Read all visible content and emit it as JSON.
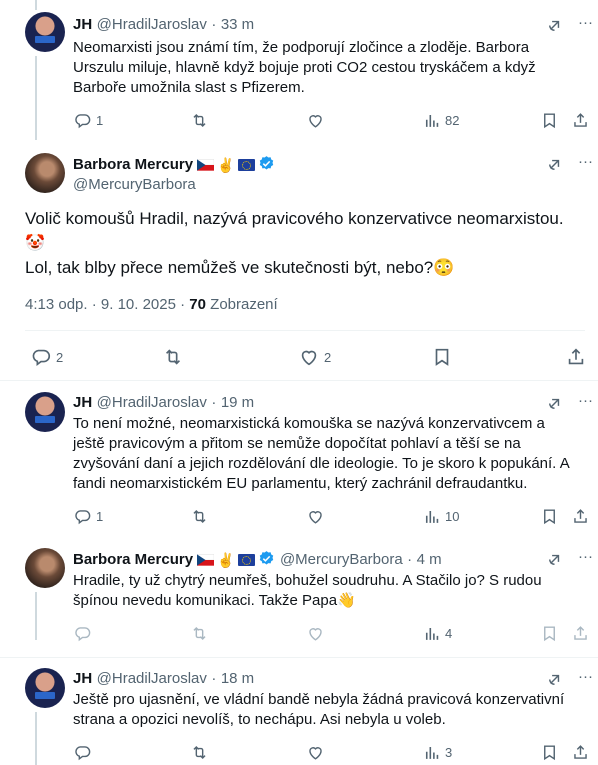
{
  "tweets": [
    {
      "name": "JH",
      "handle": "@HradilJaroslav",
      "time": "33 m",
      "text": "Neomarxisti jsou známí tím, že podporují zločince a zloděje. Barbora Urszulu miluje, hlavně když bojuje proti CO2 cestou tryskáčem a když Barboře umožnila slast s Pfizerem.",
      "replies": "1",
      "views": "82"
    },
    {
      "name": "Barbora Mercury",
      "handle": "@MercuryBarbora",
      "text_line1": "Volič komoušů Hradil, nazývá pravicového konzervativce neomarxistou.",
      "text_line2": "Lol, tak blby přece nemůžeš ve skutečnosti být, nebo?",
      "timestamp": "4:13 odp. · 9. 10. 2025",
      "views_count": "70",
      "views_label": "Zobrazení",
      "replies": "2",
      "likes": "2"
    },
    {
      "name": "JH",
      "handle": "@HradilJaroslav",
      "time": "19 m",
      "text": "To není možné, neomarxistická komouška se nazývá konzervativcem a ještě pravicovým a přitom se nemůže dopočítat pohlaví a těší se na zvyšování daní a jejich rozdělování dle ideologie. To je skoro k popukání. A fandi neomarxistickém EU parlamentu, který zachránil defraudantku.",
      "replies": "1",
      "views": "10"
    },
    {
      "name": "Barbora Mercury",
      "handle": "@MercuryBarbora",
      "time": "4 m",
      "text": "Hradile, ty už chytrý neumřeš, bohužel soudruhu. A Stačilo jo? S rudou špínou nevedu komunikaci. Takže Papa",
      "views": "4"
    },
    {
      "name": "JH",
      "handle": "@HradilJaroslav",
      "time": "18 m",
      "text": "Ještě pro ujasnění, ve vládní bandě nebyla žádná pravicová konzervativní strana a opozici nevolíš, to nechápu. Asi nebyla u voleb.",
      "views": "3"
    }
  ],
  "separator": "·",
  "colors": {
    "text": "#0f1419",
    "muted": "#536471",
    "verified": "#1d9bf0",
    "line": "#cfd9de"
  }
}
